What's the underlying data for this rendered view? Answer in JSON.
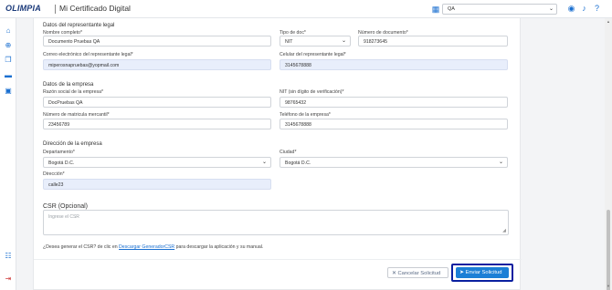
{
  "header": {
    "brand": "OLIMPIA",
    "app_title": "Mi Certificado Digital",
    "org_value": "QA",
    "icons": [
      "building-icon",
      "user-icon",
      "bell-icon",
      "help-icon"
    ]
  },
  "sidebar": {
    "icons": [
      "home-icon",
      "add-icon",
      "certificates-icon",
      "folder-icon",
      "profile-icon",
      "users-icon",
      "logout-icon"
    ]
  },
  "legal_rep": {
    "section_title": "Datos del representante legal",
    "full_name_label": "Nombre completo*",
    "full_name_value": "Documento Pruebas QA",
    "doc_type_label": "Tipo de doc*",
    "doc_type_value": "NIT",
    "doc_number_label": "Número de documento*",
    "doc_number_value": "918273645",
    "email_label": "Correo electrónico del representante legal*",
    "email_value": "miperosnapruebas@yopmail.com",
    "phone_label": "Celular del representante legal*",
    "phone_value": "3145678888"
  },
  "company": {
    "section_title": "Datos de la empresa",
    "name_label": "Razón social de la empresa*",
    "name_value": "DocPruebas QA",
    "nit_label": "NIT (sin dígito de verificación)*",
    "nit_value": "98765432",
    "registration_label": "Número de matricula mercantil*",
    "registration_value": "23456789",
    "phone_label": "Teléfono de la empresa*",
    "phone_value": "3145678888"
  },
  "address": {
    "section_title": "Dirección de la empresa",
    "department_label": "Departamento*",
    "department_value": "Bogotá D.C.",
    "city_label": "Ciudad*",
    "city_value": "Bogotá D.C.",
    "address_label": "Dirección*",
    "address_value": "calle23"
  },
  "csr": {
    "title": "CSR (Opcional)",
    "placeholder": "Ingrese el CSR",
    "help_prefix": "¿Desea generar el CSR? de clic en ",
    "help_link": "Descargar GeneradorCSR",
    "help_suffix": " para descargar la aplicación y su manual."
  },
  "actions": {
    "cancel_label": "✕ Cancelar Solicitud",
    "send_label": "➤ Enviar Solicitud"
  }
}
